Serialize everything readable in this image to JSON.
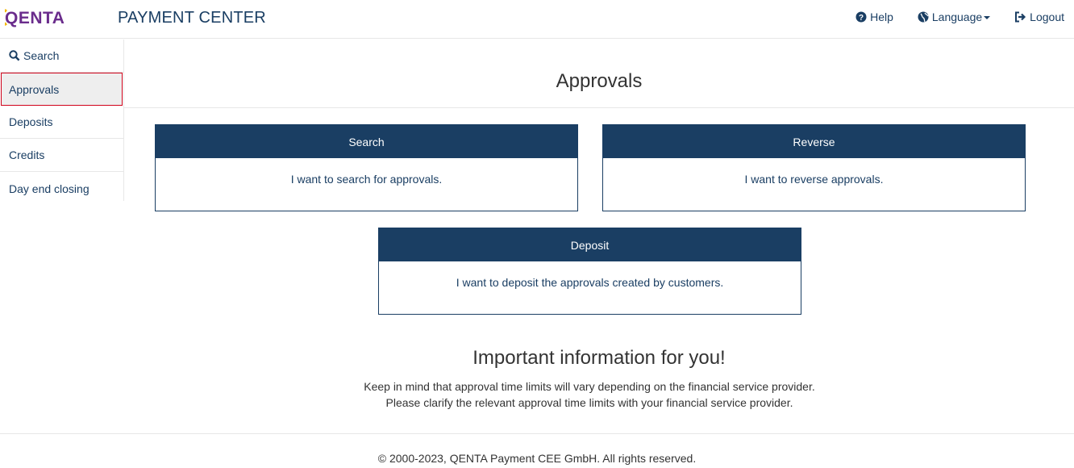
{
  "header": {
    "logo_text": "QENTA",
    "brand": "PAYMENT CENTER",
    "help": "Help",
    "language": "Language",
    "logout": "Logout"
  },
  "sidebar": {
    "items": [
      {
        "label": "Search"
      },
      {
        "label": "Approvals"
      },
      {
        "label": "Deposits"
      },
      {
        "label": "Credits"
      },
      {
        "label": "Day end closing"
      }
    ]
  },
  "main": {
    "title": "Approvals",
    "cards": [
      {
        "title": "Search",
        "text": "I want to search for approvals."
      },
      {
        "title": "Reverse",
        "text": "I want to reverse approvals."
      },
      {
        "title": "Deposit",
        "text": "I want to deposit the approvals created by customers."
      }
    ],
    "info_title": "Important information for you!",
    "info_line1": "Keep in mind that approval time limits will vary depending on the financial service provider.",
    "info_line2": "Please clarify the relevant approval time limits with your financial service provider."
  },
  "footer": {
    "copyright": "© 2000-2023, QENTA Payment CEE GmbH. All rights reserved."
  },
  "colors": {
    "primary": "#1a3e63",
    "logo_yellow": "#f5b800",
    "logo_purple": "#6a2c8c",
    "active_border": "#d0021b"
  }
}
